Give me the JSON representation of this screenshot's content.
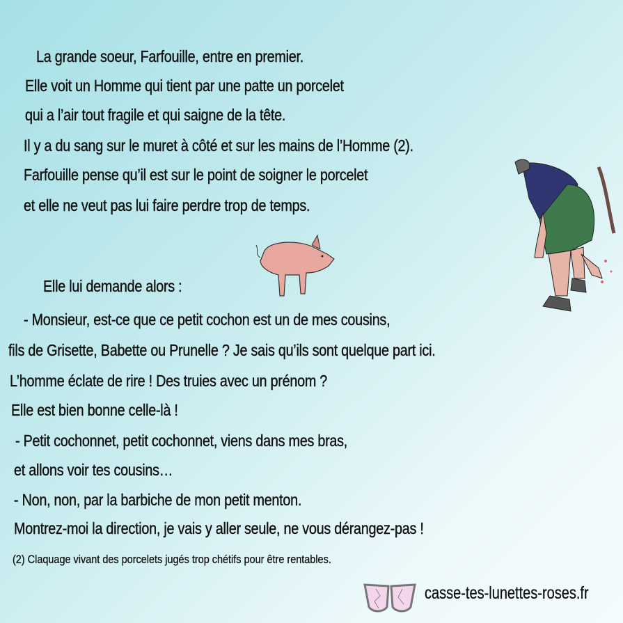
{
  "story": {
    "lines": [
      "La grande soeur, Farfouille, entre en premier.",
      "Elle voit un Homme qui tient par une patte un porcelet",
      "qui a l’air tout fragile et qui saigne de la tête.",
      "Il y a du sang sur le muret à côté et sur les mains de l’Homme (2).",
      "Farfouille pense qu’il est sur le point de soigner le porcelet",
      "et elle ne veut pas lui faire perdre trop de temps.",
      "Elle lui demande alors :",
      "- Monsieur, est-ce que ce petit cochon est un de mes cousins,",
      "fils de Grisette, Babette ou Prunelle  ? Je sais qu’ils sont quelque part ici.",
      "L’homme éclate de rire  ! Des truies avec un prénom  ?",
      "Elle est bien bonne celle-là  !",
      "- Petit cochonnet, petit cochonnet, viens dans mes bras,",
      "et allons voir tes cousins…",
      "- Non, non, par la barbiche de mon petit menton.",
      "Montrez-moi la direction, je vais y aller seule, ne vous dérangez-pas  !"
    ]
  },
  "footnote": "(2)  Claquage vivant des porcelets jugés trop chétifs pour être rentables.",
  "site": "casse-tes-lunettes-roses.fr"
}
